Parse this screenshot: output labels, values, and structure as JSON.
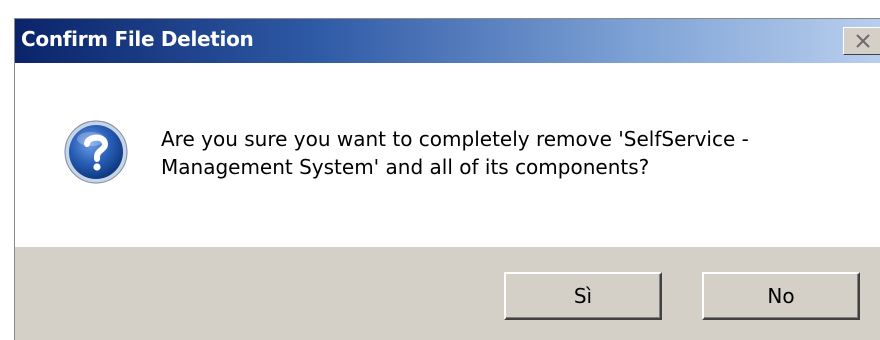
{
  "dialog": {
    "title": "Confirm File Deletion",
    "message_line1": "Are you sure you want to completely remove 'SelfService -",
    "message_line2": "Management System' and all of its components?",
    "icon": "question-icon",
    "close_icon": "close-icon"
  },
  "buttons": {
    "yes_label": "Sì",
    "no_label": "No"
  },
  "colors": {
    "titlebar_start": "#0a246a",
    "titlebar_end": "#b9cfee",
    "button_face": "#d4d0c8",
    "icon_blue": "#1f4fa3"
  }
}
